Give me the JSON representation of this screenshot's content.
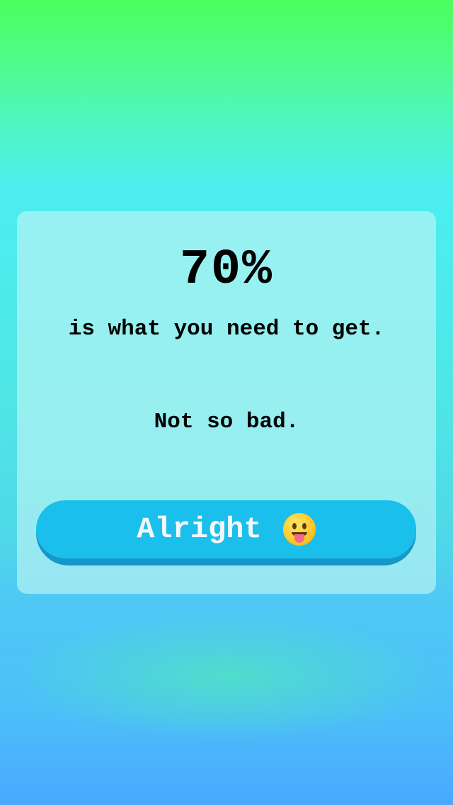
{
  "result": {
    "percent": "70%",
    "subtitle": "is what you need to get.",
    "verdict": "Not so bad."
  },
  "action": {
    "button_label": "Alright",
    "button_icon": "face-with-tongue-emoji"
  },
  "colors": {
    "background_top": "#4cff5e",
    "background_middle": "#4ceef0",
    "background_bottom": "#4aa8ff",
    "button": "#1bbfec",
    "button_shadow": "#1597c8",
    "button_text": "#f4f8fa"
  }
}
